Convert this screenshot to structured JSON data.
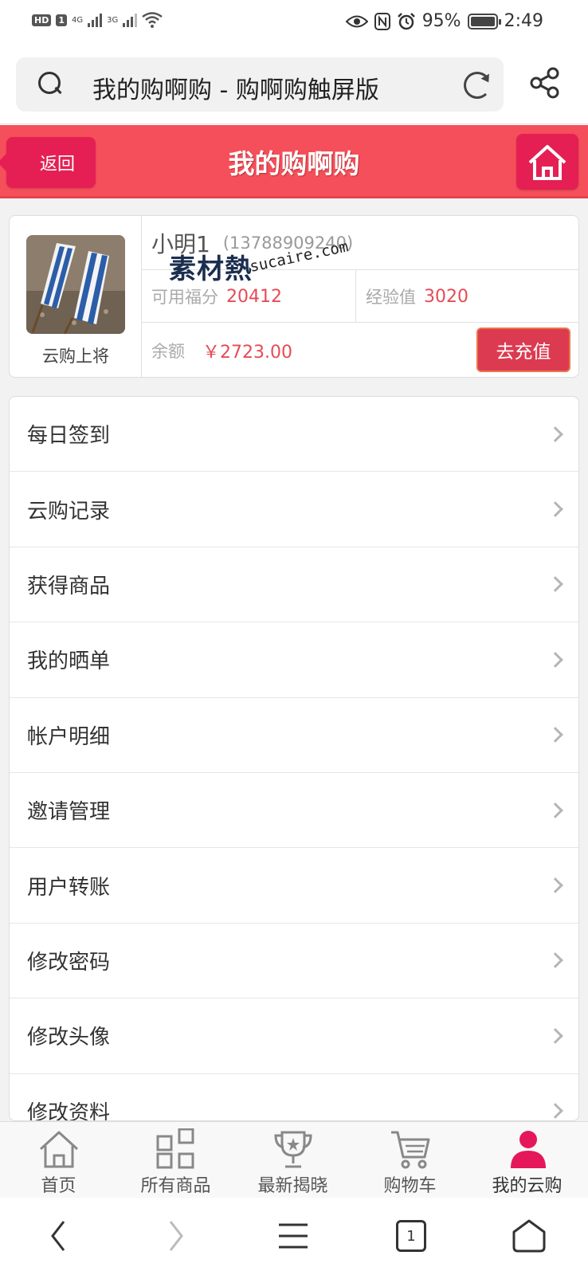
{
  "status_bar": {
    "hd": "HD",
    "sim": "1",
    "net1": "4G",
    "net2": "3G",
    "battery": "95%",
    "time": "2:49"
  },
  "browser": {
    "url_title": "我的购啊购 - 购啊购触屏版",
    "icons": [
      "search-icon",
      "reload-icon",
      "share-icon"
    ]
  },
  "header": {
    "back_label": "返回",
    "title": "我的购啊购",
    "home_icon": "home-icon"
  },
  "profile": {
    "level": "云购上将",
    "name": "小明1",
    "phone": "(13788909240)",
    "points_label": "可用福分",
    "points": "20412",
    "exp_label": "经验值",
    "exp": "3020",
    "balance_label": "余额",
    "balance": "￥2723.00",
    "recharge_label": "去充值"
  },
  "watermark": {
    "cn": "素材熱",
    "en": "sucaire.com"
  },
  "menu": {
    "items": [
      {
        "label": "每日签到"
      },
      {
        "label": "云购记录"
      },
      {
        "label": "获得商品"
      },
      {
        "label": "我的晒单"
      },
      {
        "label": "帐户明细"
      },
      {
        "label": "邀请管理"
      },
      {
        "label": "用户转账"
      },
      {
        "label": "修改密码"
      },
      {
        "label": "修改头像"
      },
      {
        "label": "修改资料"
      }
    ]
  },
  "tabbar": {
    "items": [
      {
        "label": "首页",
        "icon": "home-outline-icon"
      },
      {
        "label": "所有商品",
        "icon": "grid-icon"
      },
      {
        "label": "最新揭晓",
        "icon": "trophy-icon"
      },
      {
        "label": "购物车",
        "icon": "cart-icon"
      },
      {
        "label": "我的云购",
        "icon": "user-icon"
      }
    ],
    "active_color": "#e5175a"
  },
  "nav": {
    "tab_count": "1"
  },
  "colors": {
    "header_bg": "#f44f5a",
    "accent": "#e51f53",
    "value_red": "#e64b55"
  }
}
